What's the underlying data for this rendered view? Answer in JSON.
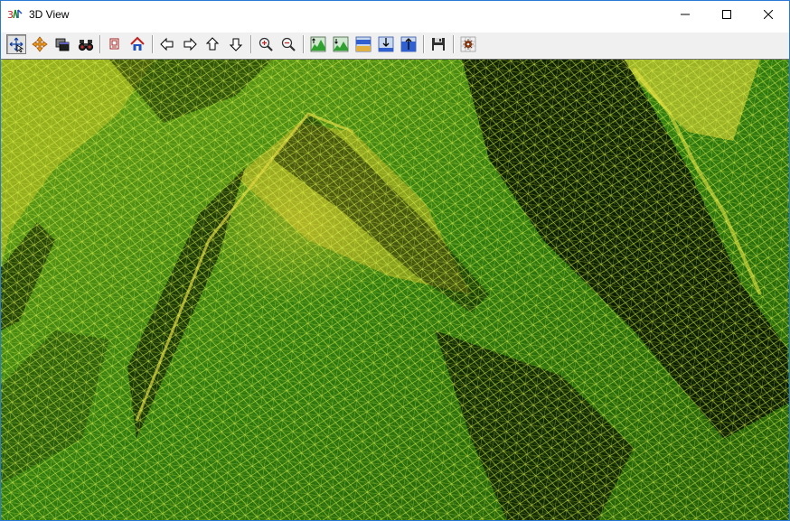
{
  "window": {
    "title": "3D View",
    "app_icon": "3d-view-app-icon",
    "controls": [
      "minimize-icon",
      "maximize-icon",
      "close-icon"
    ]
  },
  "toolbar": {
    "buttons": [
      {
        "name": "rotate-tool-button",
        "icon": "rotate-cursor-icon",
        "pressed": true
      },
      {
        "name": "pan-tool-button",
        "icon": "move-cross-icon"
      },
      {
        "name": "window-button",
        "icon": "overlapping-windows-icon"
      },
      {
        "name": "binoculars-button",
        "icon": "binoculars-icon"
      },
      {
        "name": "copy-button",
        "icon": "copy-icon"
      },
      {
        "name": "home-button",
        "icon": "home-icon"
      },
      {
        "name": "left-button",
        "icon": "arrow-left-icon"
      },
      {
        "name": "right-button",
        "icon": "arrow-right-icon"
      },
      {
        "name": "up-button",
        "icon": "arrow-up-icon"
      },
      {
        "name": "down-button",
        "icon": "arrow-down-icon"
      },
      {
        "name": "zoom-in-button",
        "icon": "zoom-in-icon"
      },
      {
        "name": "zoom-out-button",
        "icon": "zoom-out-icon"
      },
      {
        "name": "exaggeration-up-button",
        "icon": "terrain-up-icon"
      },
      {
        "name": "exaggeration-down-button",
        "icon": "terrain-down-icon"
      },
      {
        "name": "surface-button",
        "icon": "surface-layer-icon"
      },
      {
        "name": "lower-button",
        "icon": "arrow-down-to-base-icon"
      },
      {
        "name": "raise-button",
        "icon": "arrow-up-from-base-icon"
      },
      {
        "name": "save-button",
        "icon": "floppy-disk-icon"
      },
      {
        "name": "settings-button",
        "icon": "settings-grid-icon"
      }
    ]
  },
  "viewport": {
    "content": "3d-terrain-wireframe",
    "colors": {
      "low": "#000000",
      "mid": "#3fae12",
      "high": "#c8d020",
      "wire": "#d8f040"
    }
  }
}
